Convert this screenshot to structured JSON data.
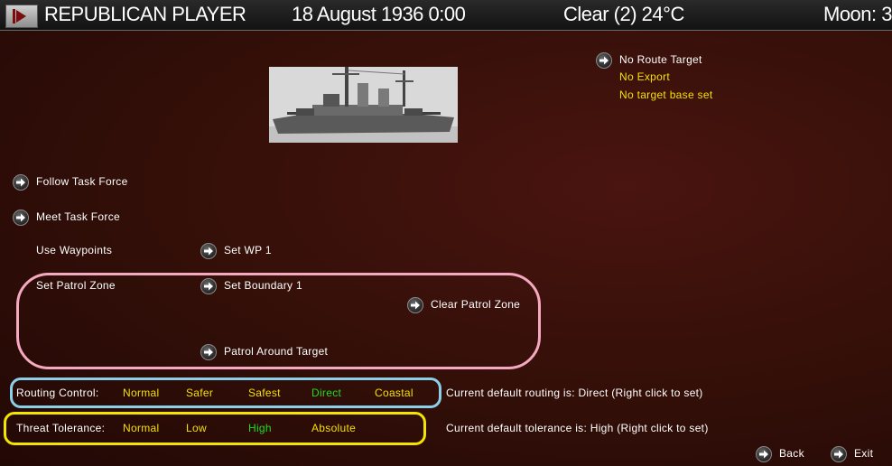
{
  "topbar": {
    "player": "REPUBLICAN PLAYER",
    "date": "18 August 1936 0:00",
    "weather": "Clear (2) 24°C",
    "moon": "Moon: 3"
  },
  "route": {
    "target": "No Route Target",
    "export": "No Export",
    "base": "No target base set"
  },
  "options": {
    "follow_task_force": "Follow Task Force",
    "meet_task_force": "Meet Task Force",
    "use_waypoints": "Use Waypoints",
    "set_wp": "Set WP 1",
    "set_patrol_zone": "Set Patrol Zone",
    "set_boundary": "Set Boundary 1",
    "clear_patrol_zone": "Clear Patrol Zone",
    "patrol_around_target": "Patrol Around Target"
  },
  "routing": {
    "label": "Routing Control:",
    "choices": [
      "Normal",
      "Safer",
      "Safest",
      "Direct",
      "Coastal"
    ],
    "selected": "Direct",
    "status": "Current default routing is: Direct (Right click to set)"
  },
  "threat": {
    "label": "Threat Tolerance:",
    "choices": [
      "Normal",
      "Low",
      "High",
      "Absolute"
    ],
    "selected": "High",
    "status": "Current default tolerance is: High (Right click to set)"
  },
  "footer": {
    "back": "Back",
    "exit": "Exit"
  },
  "colors": {
    "background": "#361009",
    "option_text": "#f2e000",
    "selected_text": "#20dd20",
    "highlight_pink": "#f5a9c0",
    "highlight_blue": "#8ccfe8",
    "highlight_yellow": "#f4e500"
  },
  "icons": {
    "menu": "menu-arrow-icon",
    "action": "arrow-right-circle-icon"
  }
}
